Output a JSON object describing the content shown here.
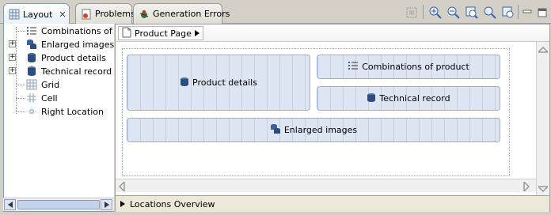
{
  "tabs": [
    {
      "label": "Layout",
      "active": true
    },
    {
      "label": "Problems",
      "active": false
    },
    {
      "label": "Generation Errors",
      "active": false
    }
  ],
  "tree": [
    {
      "label": "Combinations of product",
      "icon": "list-icon",
      "expandable": false
    },
    {
      "label": "Enlarged images",
      "icon": "database-stack-icon",
      "expandable": true
    },
    {
      "label": "Product details",
      "icon": "database-icon",
      "expandable": true
    },
    {
      "label": "Technical record",
      "icon": "database-icon",
      "expandable": true
    },
    {
      "label": "Grid",
      "icon": "grid-icon",
      "expandable": false
    },
    {
      "label": "Cell",
      "icon": "cell-icon",
      "expandable": false
    },
    {
      "label": "Right Location",
      "icon": "location-icon",
      "expandable": false
    }
  ],
  "breadcrumb": {
    "label": "Product Page"
  },
  "cells": {
    "product_details": "Product details",
    "combinations": "Combinations of product",
    "technical_record": "Technical record",
    "enlarged_images": "Enlarged images"
  },
  "footer": {
    "label": "Locations Overview"
  },
  "colors": {
    "accent": "#7f9db9",
    "cell_bg": "#dde6f2",
    "cell_border": "#9bb0cf"
  }
}
